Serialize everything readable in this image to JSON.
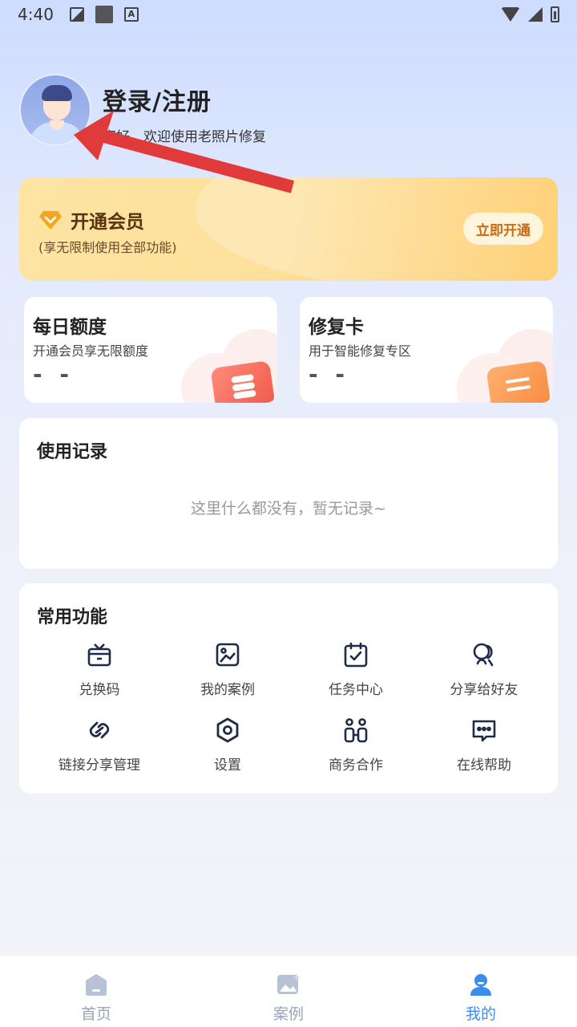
{
  "status_bar": {
    "time": "4:40"
  },
  "profile": {
    "login_label": "登录/注册",
    "welcome_text": "您好，欢迎使用老照片修复"
  },
  "vip": {
    "title": "开通会员",
    "subtitle": "(享无限制使用全部功能)",
    "button_label": "立即开通"
  },
  "quota": {
    "daily": {
      "title": "每日额度",
      "desc": "开通会员享无限额度",
      "value": "- -"
    },
    "repair_card": {
      "title": "修复卡",
      "desc": "用于智能修复专区",
      "value": "- -"
    }
  },
  "records": {
    "title": "使用记录",
    "empty_text": "这里什么都没有，暂无记录~"
  },
  "functions": {
    "title": "常用功能",
    "items": [
      {
        "label": "兑换码",
        "icon": "gift-icon"
      },
      {
        "label": "我的案例",
        "icon": "image-icon"
      },
      {
        "label": "任务中心",
        "icon": "calendar-check-icon"
      },
      {
        "label": "分享给好友",
        "icon": "share-people-icon"
      },
      {
        "label": "链接分享管理",
        "icon": "link-icon"
      },
      {
        "label": "设置",
        "icon": "settings-icon"
      },
      {
        "label": "商务合作",
        "icon": "cooperation-icon"
      },
      {
        "label": "在线帮助",
        "icon": "chat-help-icon"
      }
    ]
  },
  "tabs": [
    {
      "label": "首页",
      "icon": "home-icon",
      "active": false
    },
    {
      "label": "案例",
      "icon": "gallery-icon",
      "active": false
    },
    {
      "label": "我的",
      "icon": "user-icon",
      "active": true
    }
  ],
  "colors": {
    "accent": "#3c8cf0",
    "vip_text": "#5a3210",
    "vip_button_text": "#c86a10",
    "arrow": "#e03a3a"
  }
}
